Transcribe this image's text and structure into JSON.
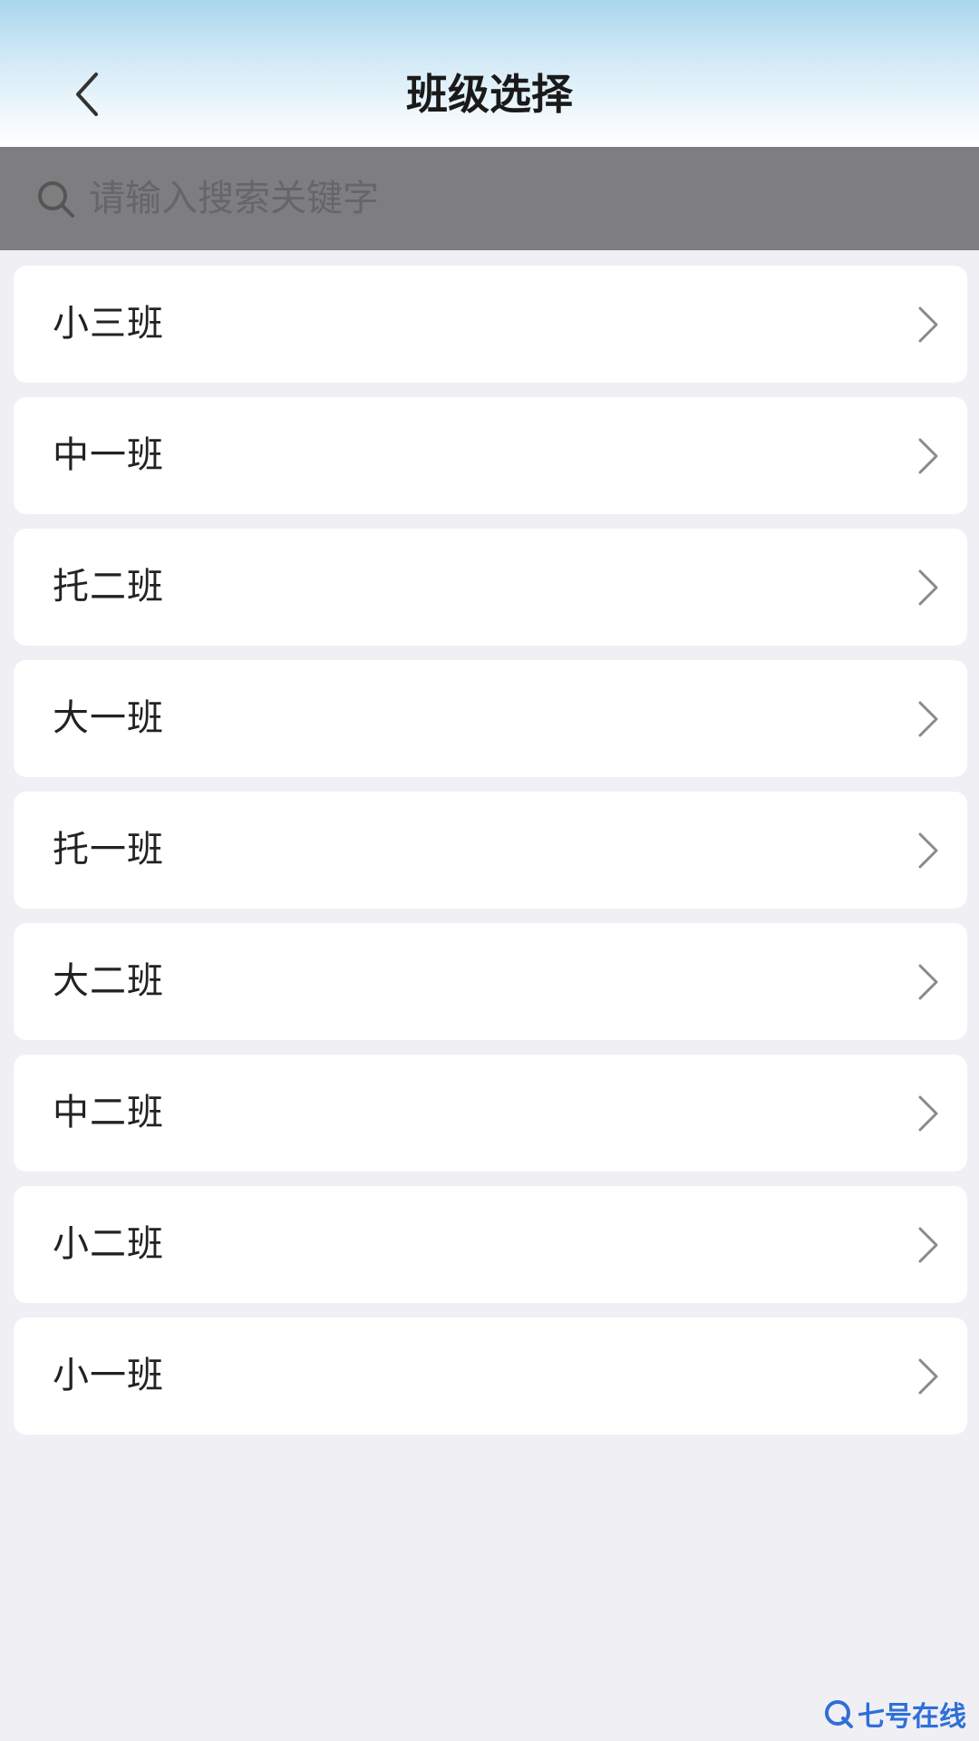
{
  "header": {
    "title": "班级选择",
    "back_icon": "chevron-left-icon"
  },
  "search": {
    "placeholder": "请输入搜索关键字",
    "value": "",
    "icon": "search-icon"
  },
  "classes": [
    {
      "label": "小三班"
    },
    {
      "label": "中一班"
    },
    {
      "label": "托二班"
    },
    {
      "label": "大一班"
    },
    {
      "label": "托一班"
    },
    {
      "label": "大二班"
    },
    {
      "label": "中二班"
    },
    {
      "label": "小二班"
    },
    {
      "label": "小一班"
    }
  ],
  "watermark": {
    "text": "七号在线"
  },
  "colors": {
    "background": "#f0eff4",
    "search_bar": "#7e7e80",
    "watermark": "#2f6fd8"
  }
}
